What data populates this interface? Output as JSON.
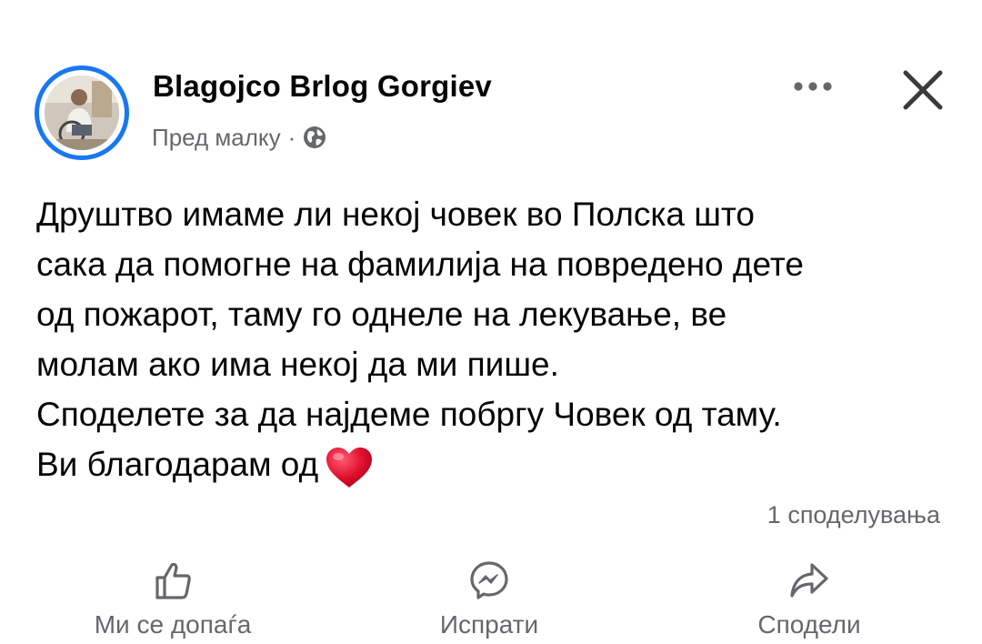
{
  "post": {
    "author": "Blagojco Brlog Gorgiev",
    "time": "Пред малку",
    "separator": "·",
    "audience_icon": "globe-icon",
    "body_lines": [
      "Друштво имаме ли некој човек во Полска што",
      "сака да помогне на фамилија на повредено дете",
      "од пожарот, таму го однеле на лекување, ве",
      "молам ако има некој да ми пише.",
      "Споделете за да најдеме побргу Човек од таму.",
      "Ви благодарам од"
    ],
    "closing_emoji": "red-heart-icon",
    "share_count": "1 споделувања"
  },
  "actions": {
    "like_label": "Ми се допаѓа",
    "send_label": "Испрати",
    "share_label": "Сподели"
  },
  "colors": {
    "accent": "#1877f2",
    "text": "#050505",
    "secondary": "#65676b",
    "heart": "#e0102f"
  }
}
